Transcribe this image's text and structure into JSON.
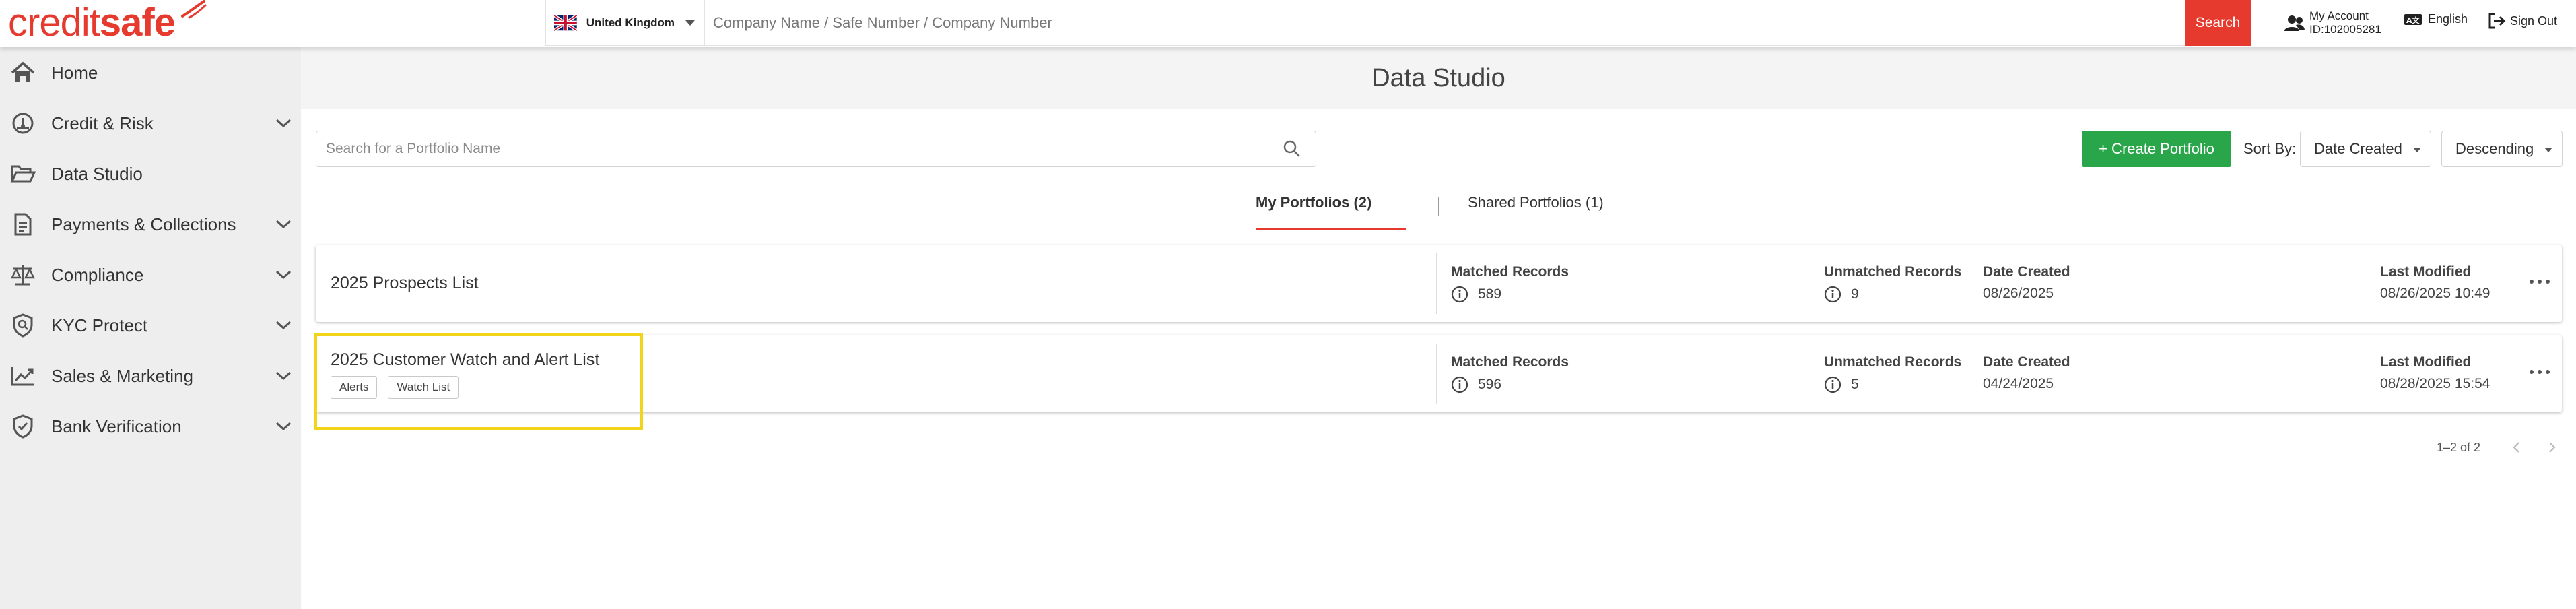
{
  "header": {
    "logo_part1": "credit",
    "logo_part2": "safe",
    "country": "United Kingdom",
    "search_placeholder": "Company Name / Safe Number / Company Number",
    "search_button": "Search",
    "account_label": "My Account",
    "account_id": "ID:102005281",
    "language": "English",
    "signout": "Sign Out"
  },
  "sidebar": {
    "items": [
      {
        "label": "Home",
        "icon": "home-icon"
      },
      {
        "label": "Credit & Risk",
        "icon": "gauge-icon"
      },
      {
        "label": "Data Studio",
        "icon": "folder-open-icon"
      },
      {
        "label": "Payments & Collections",
        "icon": "document-icon"
      },
      {
        "label": "Compliance",
        "icon": "scales-icon"
      },
      {
        "label": "KYC Protect",
        "icon": "shield-search-icon"
      },
      {
        "label": "Sales & Marketing",
        "icon": "trend-chart-icon"
      },
      {
        "label": "Bank Verification",
        "icon": "shield-check-icon"
      }
    ]
  },
  "main": {
    "title": "Data Studio",
    "portfolio_search_placeholder": "Search for a Portfolio Name",
    "create_button": "+ Create Portfolio",
    "sort_by_label": "Sort By:",
    "sort_field": "Date Created",
    "sort_order": "Descending",
    "tabs": {
      "my": "My Portfolios (2)",
      "shared": "Shared Portfolios (1)"
    },
    "columns": {
      "matched": "Matched Records",
      "unmatched": "Unmatched Records",
      "created": "Date Created",
      "modified": "Last Modified"
    },
    "portfolios": [
      {
        "name": "2025 Prospects List",
        "tags": [],
        "matched": "589",
        "unmatched": "9",
        "created": "08/26/2025",
        "modified": "08/26/2025 10:49"
      },
      {
        "name": "2025 Customer Watch and Alert List",
        "tags": [
          "Alerts",
          "Watch List"
        ],
        "matched": "596",
        "unmatched": "5",
        "created": "04/24/2025",
        "modified": "08/28/2025 15:54"
      }
    ],
    "pagination": "1–2 of 2"
  },
  "colors": {
    "brand_red": "#e63a2e",
    "create_green": "#29a64a",
    "highlight_yellow": "#f2d51b",
    "sidebar_bg": "#eeeeee"
  }
}
